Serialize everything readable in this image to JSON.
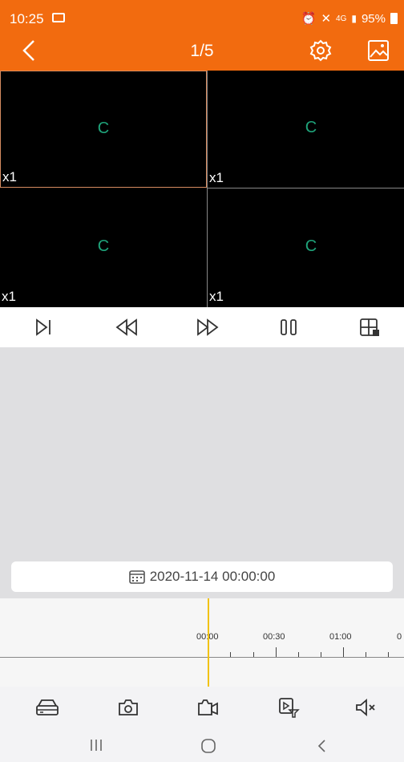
{
  "status_bar": {
    "time": "10:25",
    "network": "4G",
    "battery": "95%"
  },
  "header": {
    "title": "1/5"
  },
  "video_cells": [
    {
      "status": "C",
      "speed": "x1"
    },
    {
      "status": "C",
      "speed": "x1"
    },
    {
      "status": "C",
      "speed": "x1"
    },
    {
      "status": "C",
      "speed": "x1"
    }
  ],
  "date_selector": {
    "datetime": "2020-11-14 00:00:00"
  },
  "timeline": {
    "labels": [
      "00:00",
      "00:30",
      "01:00",
      "0"
    ]
  },
  "colors": {
    "accent": "#f26b0f",
    "cursor": "#f1c20a",
    "loading": "#1fa37a"
  }
}
